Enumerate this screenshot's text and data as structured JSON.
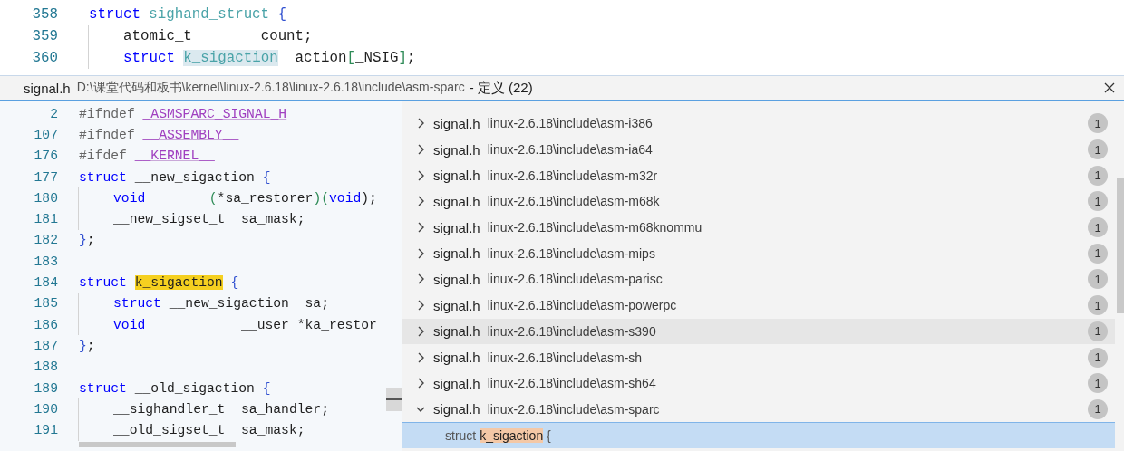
{
  "editor_lines": [
    {
      "number": "358",
      "indented": false,
      "tokens": [
        {
          "text": "struct ",
          "kind": "keyword"
        },
        {
          "text": "sighand_struct",
          "kind": "type"
        },
        {
          "text": " {",
          "kind": "brace"
        }
      ]
    },
    {
      "number": "359",
      "indented": true,
      "tokens": [
        {
          "text": "atomic_t        count;",
          "kind": "plain"
        }
      ]
    },
    {
      "number": "360",
      "indented": true,
      "tokens": [
        {
          "text": "struct ",
          "kind": "keyword"
        },
        {
          "text": "k_sigaction",
          "kind": "reference"
        },
        {
          "text": "  action",
          "kind": "plain"
        },
        {
          "text": "[",
          "kind": "punct"
        },
        {
          "text": "_NSIG",
          "kind": "plain"
        },
        {
          "text": "]",
          "kind": "punct"
        },
        {
          "text": ";",
          "kind": "plain"
        }
      ]
    }
  ],
  "peek": {
    "file": "signal.h",
    "path": "D:\\课堂代码和板书\\kernel\\linux-2.6.18\\linux-2.6.18\\include\\asm-sparc",
    "title": "- 定义 (22)",
    "code_lines": [
      {
        "number": "2",
        "indented": false,
        "tokens": [
          {
            "text": "#ifndef ",
            "kind": "directive"
          },
          {
            "text": "_ASMSPARC_SIGNAL_H",
            "kind": "macro"
          }
        ]
      },
      {
        "number": "107",
        "indented": false,
        "tokens": [
          {
            "text": "#ifndef ",
            "kind": "directive"
          },
          {
            "text": "__ASSEMBLY__",
            "kind": "macro"
          }
        ]
      },
      {
        "number": "176",
        "indented": false,
        "tokens": [
          {
            "text": "#ifdef ",
            "kind": "directive"
          },
          {
            "text": "__KERNEL__",
            "kind": "macro"
          }
        ]
      },
      {
        "number": "177",
        "indented": false,
        "tokens": [
          {
            "text": "struct ",
            "kind": "keyword"
          },
          {
            "text": "__new_sigaction ",
            "kind": "plain"
          },
          {
            "text": "{",
            "kind": "brace"
          }
        ]
      },
      {
        "number": "180",
        "indented": true,
        "tokens": [
          {
            "text": "void",
            "kind": "keyword"
          },
          {
            "text": "        (",
            "kind": "punct"
          },
          {
            "text": "*sa_restorer",
            "kind": "plain"
          },
          {
            "text": ")(",
            "kind": "punct"
          },
          {
            "text": "void",
            "kind": "keyword"
          },
          {
            "text": ");",
            "kind": "plain"
          }
        ]
      },
      {
        "number": "181",
        "indented": true,
        "tokens": [
          {
            "text": "__new_sigset_t  sa_mask;",
            "kind": "plain"
          }
        ]
      },
      {
        "number": "182",
        "indented": false,
        "tokens": [
          {
            "text": "}",
            "kind": "brace"
          },
          {
            "text": ";",
            "kind": "plain"
          }
        ]
      },
      {
        "number": "183",
        "indented": false
      },
      {
        "number": "184",
        "indented": false,
        "tokens": [
          {
            "text": "struct ",
            "kind": "keyword"
          },
          {
            "text": "k_sigaction",
            "kind": "match"
          },
          {
            "text": " {",
            "kind": "brace"
          }
        ]
      },
      {
        "number": "185",
        "indented": true,
        "tokens": [
          {
            "text": "struct ",
            "kind": "keyword"
          },
          {
            "text": "__new_sigaction  sa;",
            "kind": "plain"
          }
        ]
      },
      {
        "number": "186",
        "indented": true,
        "tokens": [
          {
            "text": "void",
            "kind": "keyword"
          },
          {
            "text": "            __user *ka_restor",
            "kind": "plain"
          }
        ]
      },
      {
        "number": "187",
        "indented": false,
        "tokens": [
          {
            "text": "}",
            "kind": "brace"
          },
          {
            "text": ";",
            "kind": "plain"
          }
        ]
      },
      {
        "number": "188",
        "indented": false
      },
      {
        "number": "189",
        "indented": false,
        "tokens": [
          {
            "text": "struct ",
            "kind": "keyword"
          },
          {
            "text": "__old_sigaction ",
            "kind": "plain"
          },
          {
            "text": "{",
            "kind": "brace"
          }
        ]
      },
      {
        "number": "190",
        "indented": true,
        "tokens": [
          {
            "text": "__sighandler_t  sa_handler;",
            "kind": "plain"
          }
        ]
      },
      {
        "number": "191",
        "indented": true,
        "tokens": [
          {
            "text": "__old_sigset_t  sa_mask;",
            "kind": "plain"
          }
        ]
      }
    ],
    "references": [
      {
        "file": "signal.h",
        "path": "linux-2.6.18\\include\\asm-i386",
        "count": "1",
        "expanded": false,
        "hovered": false
      },
      {
        "file": "signal.h",
        "path": "linux-2.6.18\\include\\asm-ia64",
        "count": "1",
        "expanded": false,
        "hovered": false
      },
      {
        "file": "signal.h",
        "path": "linux-2.6.18\\include\\asm-m32r",
        "count": "1",
        "expanded": false,
        "hovered": false
      },
      {
        "file": "signal.h",
        "path": "linux-2.6.18\\include\\asm-m68k",
        "count": "1",
        "expanded": false,
        "hovered": false
      },
      {
        "file": "signal.h",
        "path": "linux-2.6.18\\include\\asm-m68knommu",
        "count": "1",
        "expanded": false,
        "hovered": false
      },
      {
        "file": "signal.h",
        "path": "linux-2.6.18\\include\\asm-mips",
        "count": "1",
        "expanded": false,
        "hovered": false
      },
      {
        "file": "signal.h",
        "path": "linux-2.6.18\\include\\asm-parisc",
        "count": "1",
        "expanded": false,
        "hovered": false
      },
      {
        "file": "signal.h",
        "path": "linux-2.6.18\\include\\asm-powerpc",
        "count": "1",
        "expanded": false,
        "hovered": false
      },
      {
        "file": "signal.h",
        "path": "linux-2.6.18\\include\\asm-s390",
        "count": "1",
        "expanded": false,
        "hovered": true
      },
      {
        "file": "signal.h",
        "path": "linux-2.6.18\\include\\asm-sh",
        "count": "1",
        "expanded": false,
        "hovered": false
      },
      {
        "file": "signal.h",
        "path": "linux-2.6.18\\include\\asm-sh64",
        "count": "1",
        "expanded": false,
        "hovered": false
      },
      {
        "file": "signal.h",
        "path": "linux-2.6.18\\include\\asm-sparc",
        "count": "1",
        "expanded": true,
        "hovered": false,
        "children": [
          {
            "before": "struct ",
            "match": "k_sigaction",
            "after": " {",
            "selected": true
          }
        ]
      }
    ]
  }
}
